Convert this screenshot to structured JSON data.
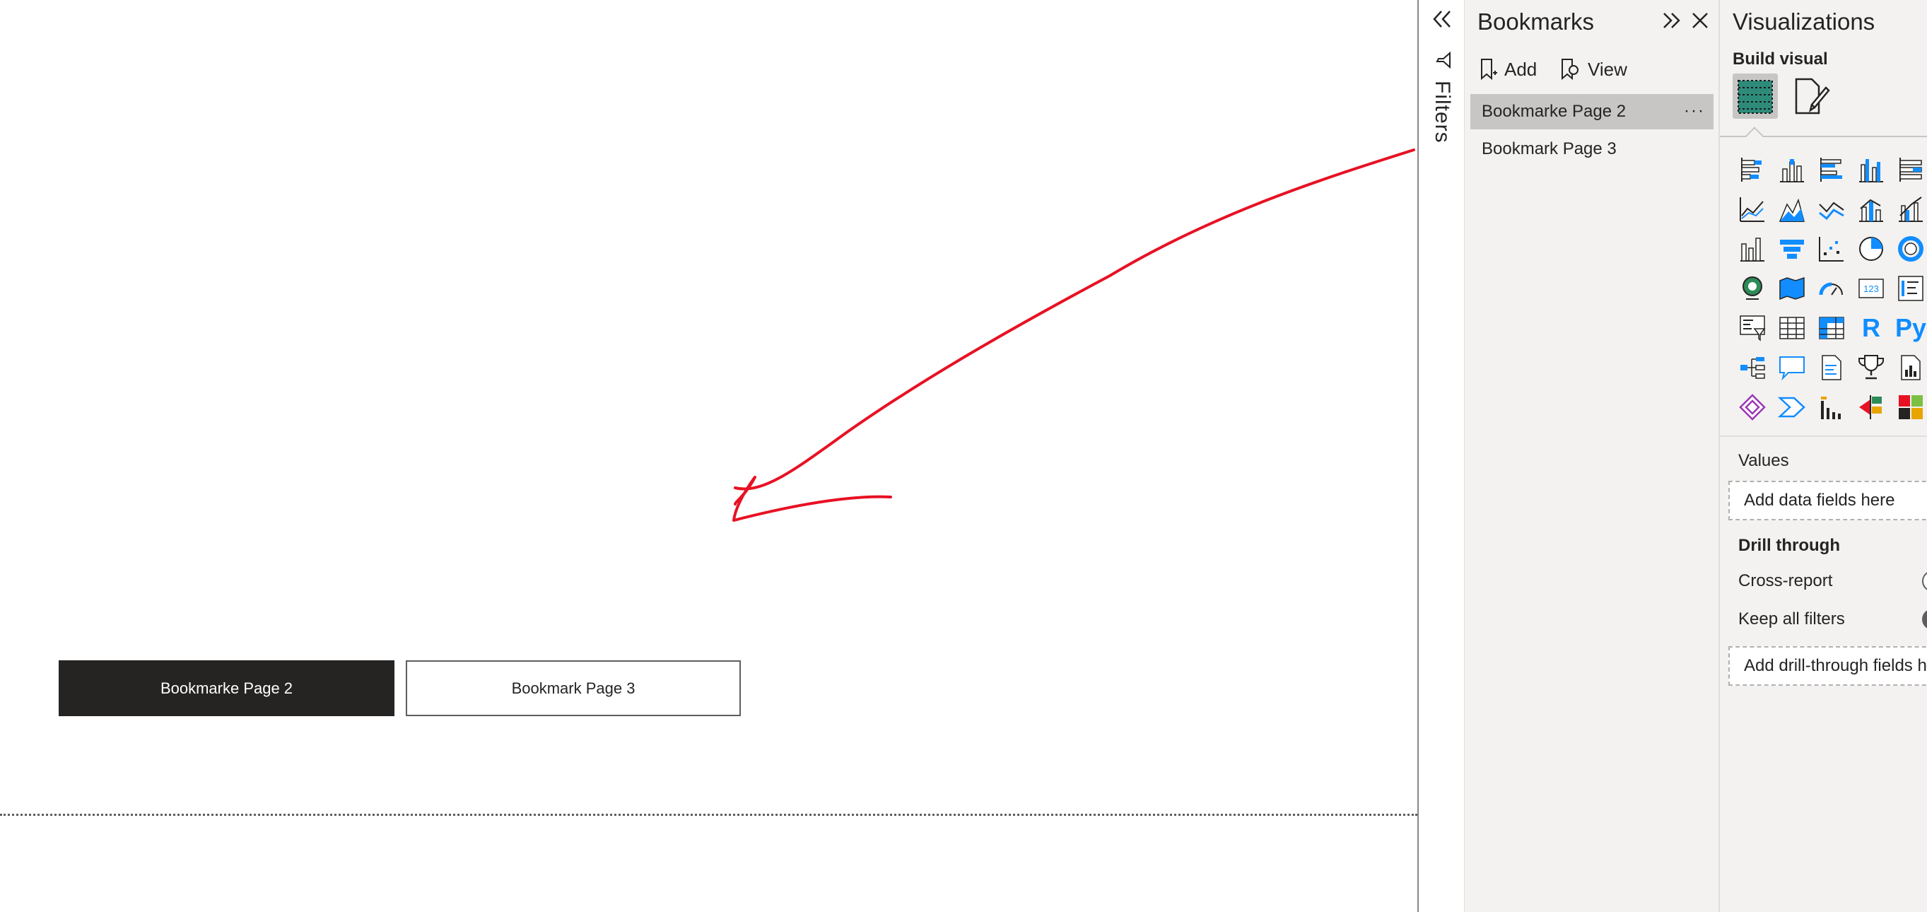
{
  "canvas": {
    "buttons": [
      {
        "label": "Bookmarke Page 2"
      },
      {
        "label": "Bookmark Page 3"
      }
    ]
  },
  "filters": {
    "label": "Filters"
  },
  "bookmarks": {
    "title": "Bookmarks",
    "add_label": "Add",
    "view_label": "View",
    "items": [
      {
        "label": "Bookmarke Page 2",
        "selected": true,
        "more": "···"
      },
      {
        "label": "Bookmark Page 3",
        "selected": false
      }
    ]
  },
  "visualizations": {
    "title": "Visualizations",
    "subtitle": "Build visual",
    "icons": [
      "stacked-bar-chart-icon",
      "stacked-column-chart-icon",
      "clustered-bar-chart-icon",
      "clustered-column-chart-icon",
      "100-stacked-bar-chart-icon",
      "line-chart-icon",
      "area-chart-icon",
      "stacked-area-chart-icon",
      "line-and-column-chart-icon",
      "line-and-clustered-column-chart-icon",
      "ribbon-chart-icon",
      "funnel-chart-icon",
      "scatter-chart-icon",
      "pie-chart-icon",
      "donut-chart-icon",
      "map-icon",
      "filled-map-icon",
      "gauge-icon",
      "card-icon",
      "multi-row-card-icon",
      "slicer-icon",
      "table-icon",
      "matrix-icon",
      "r-visual-icon",
      "python-visual-icon",
      "decomposition-tree-icon",
      "qna-icon",
      "smart-narrative-icon",
      "key-influencers-icon",
      "paginated-report-icon",
      "power-apps-icon",
      "power-automate-icon",
      "custom-visual-1-icon",
      "custom-visual-2-icon",
      "custom-visual-3-icon"
    ],
    "r_label": "R",
    "py_label": "Py",
    "card_label": "123",
    "values_label": "Values",
    "values_placeholder": "Add data fields here",
    "drill_through_label": "Drill through",
    "cross_report_label": "Cross-report",
    "keep_all_filters_label": "Keep all filters",
    "drill_placeholder": "Add drill-through fields here"
  },
  "colors": {
    "accent": "#118dff",
    "annotation": "#e81123",
    "selected_button": "#252423",
    "pane_background": "#f3f2f1"
  }
}
